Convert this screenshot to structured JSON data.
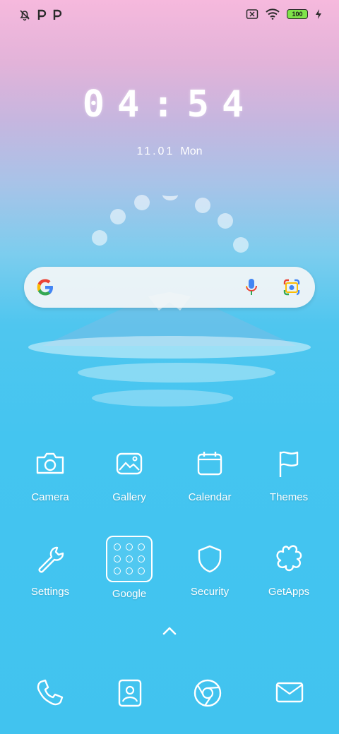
{
  "status_bar": {
    "left_icons": [
      "notifications-off-icon",
      "p-notification-icon",
      "p-notification-icon"
    ],
    "right_icons": [
      "sim-off-icon",
      "wifi-icon",
      "battery-icon",
      "charging-icon"
    ],
    "battery_level": "100"
  },
  "lockclock": {
    "time": "04:54",
    "date": "11.01",
    "weekday": "Mon"
  },
  "search_bar": {
    "icons": [
      "google-g-icon",
      "microphone-icon",
      "google-lens-icon"
    ]
  },
  "apps_row1": [
    {
      "label": "Camera",
      "icon": "camera-icon"
    },
    {
      "label": "Gallery",
      "icon": "gallery-icon"
    },
    {
      "label": "Calendar",
      "icon": "calendar-icon"
    },
    {
      "label": "Themes",
      "icon": "flag-icon"
    }
  ],
  "apps_row2": [
    {
      "label": "Settings",
      "icon": "wrench-icon"
    },
    {
      "label": "Google",
      "icon": "folder-icon"
    },
    {
      "label": "Security",
      "icon": "shield-icon"
    },
    {
      "label": "GetApps",
      "icon": "flower-icon"
    }
  ],
  "dock": [
    {
      "icon": "phone-icon"
    },
    {
      "icon": "contacts-icon"
    },
    {
      "icon": "chrome-icon"
    },
    {
      "icon": "messages-icon"
    }
  ],
  "colors": {
    "top": "#f6b9dd",
    "bottom": "#41c3ef",
    "battery_fill": "#7fe34a"
  }
}
